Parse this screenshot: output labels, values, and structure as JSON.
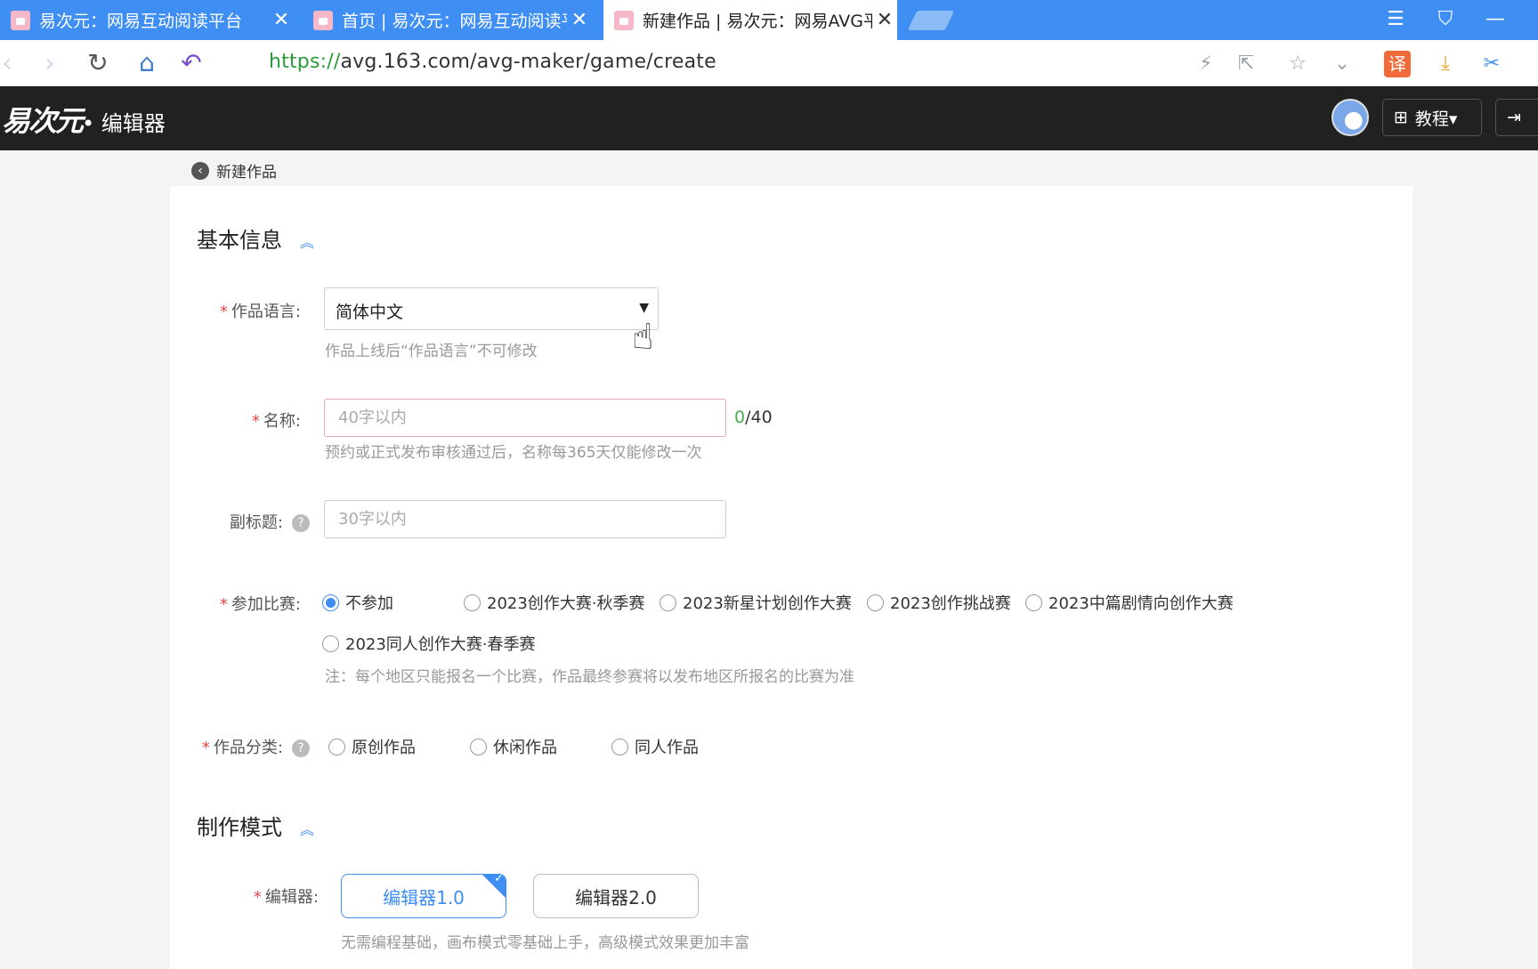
{
  "browser": {
    "tabs": [
      {
        "title": "易次元：网易互动阅读平台"
      },
      {
        "title": "首页 | 易次元：网易互动阅读平"
      },
      {
        "title": "新建作品 | 易次元：网易AVG平"
      }
    ],
    "url_scheme": "https://",
    "url_rest": "avg.163.com/avg-maker/game/create",
    "translate_label": "译"
  },
  "app": {
    "logo_text": "易次元",
    "name": "• 编辑器",
    "tutorial_label": "教程▾"
  },
  "page": {
    "back_label": "新建作品",
    "section_basic": "基本信息",
    "section_mode": "制作模式"
  },
  "form": {
    "language_label": "作品语言:",
    "language_value": "简体中文",
    "language_hint": "作品上线后“作品语言”不可修改",
    "name_label": "名称:",
    "name_placeholder": "40字以内",
    "name_count": "0",
    "name_max": "/40",
    "name_hint": "预约或正式发布审核通过后，名称每365天仅能修改一次",
    "subtitle_label": "副标题:",
    "subtitle_placeholder": "30字以内",
    "contest_label": "参加比赛:",
    "contest_options": [
      "不参加",
      "2023创作大赛·秋季赛",
      "2023新星计划创作大赛",
      "2023创作挑战赛",
      "2023中篇剧情向创作大赛",
      "2023同人创作大赛·春季赛"
    ],
    "contest_selected": "不参加",
    "contest_note": "注：每个地区只能报名一个比赛，作品最终参赛将以发布地区所报名的比赛为准",
    "category_label": "作品分类:",
    "category_options": [
      "原创作品",
      "休闲作品",
      "同人作品"
    ],
    "editor_label": "编辑器:",
    "editor_options": [
      "编辑器1.0",
      "编辑器2.0"
    ],
    "editor_selected": "编辑器1.0",
    "editor_hint": "无需编程基础，画布模式零基础上手，高级模式效果更加丰富"
  }
}
